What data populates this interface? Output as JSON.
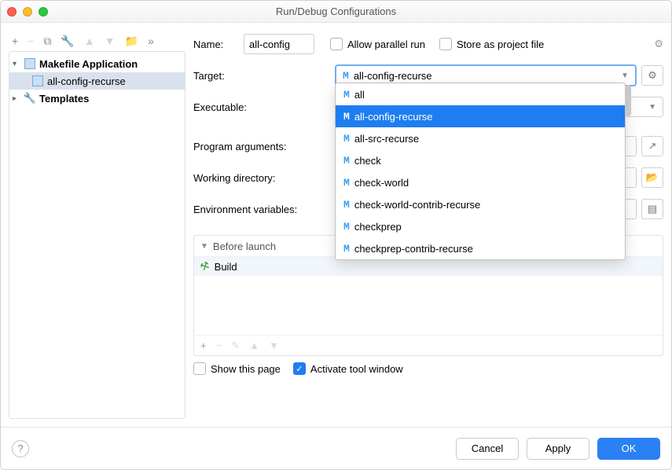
{
  "window": {
    "title": "Run/Debug Configurations"
  },
  "tree": {
    "top": {
      "label": "Makefile Application"
    },
    "child": {
      "label": "all-config-recurse"
    },
    "templates": {
      "label": "Templates"
    }
  },
  "form": {
    "name_label": "Name:",
    "name_value": "all-config",
    "allow_parallel": "Allow parallel run",
    "store_project": "Store as project file",
    "target_label": "Target:",
    "target_value": "all-config-recurse",
    "executable_label": "Executable:",
    "program_args_label": "Program arguments:",
    "working_dir_label": "Working directory:",
    "env_label": "Environment variables:"
  },
  "dropdown": {
    "items": [
      "all",
      "all-config-recurse",
      "all-src-recurse",
      "check",
      "check-world",
      "check-world-contrib-recurse",
      "checkprep",
      "checkprep-contrib-recurse"
    ],
    "selected_index": 1
  },
  "before_launch": {
    "title": "Before launch",
    "item": "Build"
  },
  "bottom": {
    "show_page": "Show this page",
    "activate": "Activate tool window"
  },
  "footer": {
    "cancel": "Cancel",
    "apply": "Apply",
    "ok": "OK"
  }
}
